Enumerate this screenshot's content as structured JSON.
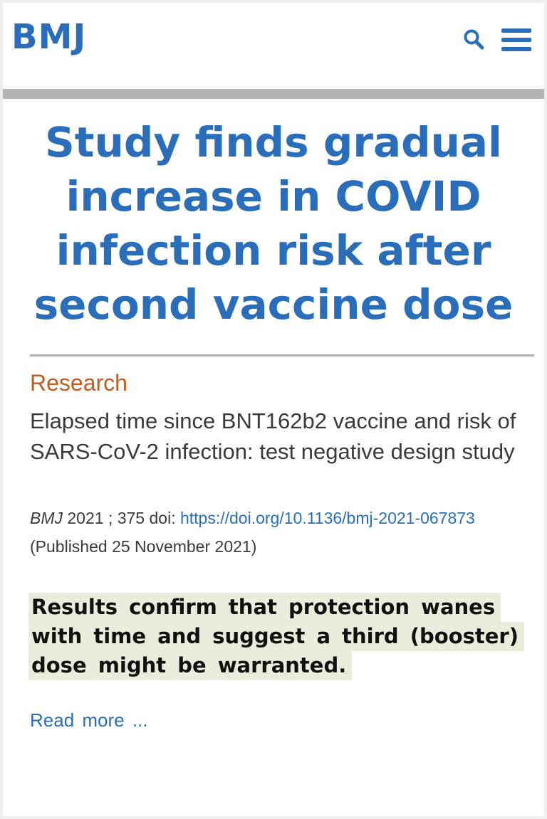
{
  "header": {
    "logo": "BMJ",
    "search_icon": "search-icon",
    "menu_icon": "hamburger-menu-icon",
    "brand_color": "#2a6ebb"
  },
  "headline": "Study finds gradual increase in COVID infection risk after second vaccine dose",
  "article": {
    "category": "Research",
    "category_color": "#c55a1c",
    "title": "Elapsed time since BNT162b2 vaccine and risk of SARS-CoV-2 infection: test negative design study",
    "citation": {
      "journal": "BMJ",
      "year_volume": "2021 ; 375",
      "doi_label": "doi:",
      "doi_link": "https://doi.org/10.1136/bmj-2021-067873",
      "published": "(Published 25 November 2021)"
    }
  },
  "highlight": {
    "lines": [
      "Results confirm that protection wanes",
      "with time and suggest a third (booster)",
      "dose might be warranted."
    ],
    "background": "#e8eedb"
  },
  "read_more": "Read more ..."
}
